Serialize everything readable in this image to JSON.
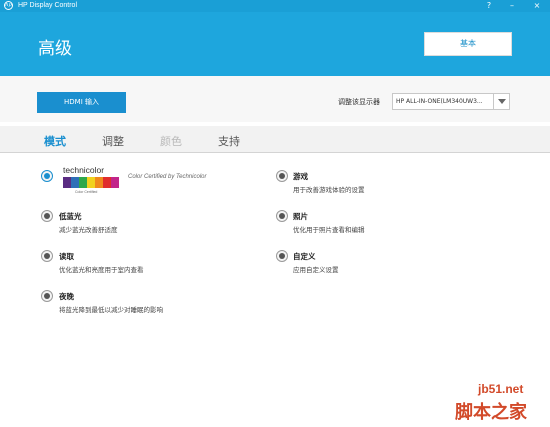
{
  "window": {
    "title": "HP Display Control",
    "help_glyph": "?",
    "minimize_glyph": "–",
    "close_glyph": "×",
    "logo_text": "hp"
  },
  "header": {
    "title": "高级",
    "basic_button": "基本"
  },
  "input_row": {
    "hdmi_button": "HDMI 输入",
    "monitor_label": "调整该显示器",
    "monitor_value": "HP ALL-IN-ONE(LM340UW3..."
  },
  "tabs": [
    {
      "label": "模式",
      "state": "active"
    },
    {
      "label": "调整",
      "state": "normal"
    },
    {
      "label": "颜色",
      "state": "disabled"
    },
    {
      "label": "支持",
      "state": "normal"
    }
  ],
  "modes": {
    "technicolor": {
      "logo_word": "technicolor",
      "logo_sub": "Color Certified",
      "certified_text": "Color Certified by Technicolor",
      "selected": true
    },
    "low_blue": {
      "title": "低蓝光",
      "desc": "减少蓝光改善舒适度"
    },
    "reading": {
      "title": "读取",
      "desc": "优化蓝光和亮度用于室内查看"
    },
    "night": {
      "title": "夜晚",
      "desc": "将蓝光降到最低以减少对睡眠的影响"
    },
    "gaming": {
      "title": "游戏",
      "desc": "用于改善游戏体验的设置"
    },
    "photo": {
      "title": "照片",
      "desc": "优化用于照片查看和编辑"
    },
    "custom": {
      "title": "自定义",
      "desc": "应用自定义设置"
    }
  },
  "watermark": {
    "site": "jb51.net",
    "name": "脚本之家"
  },
  "colors": {
    "brand_blue": "#1ea6dd",
    "button_blue": "#1a8fcf",
    "watermark_red": "#d24a2a"
  }
}
